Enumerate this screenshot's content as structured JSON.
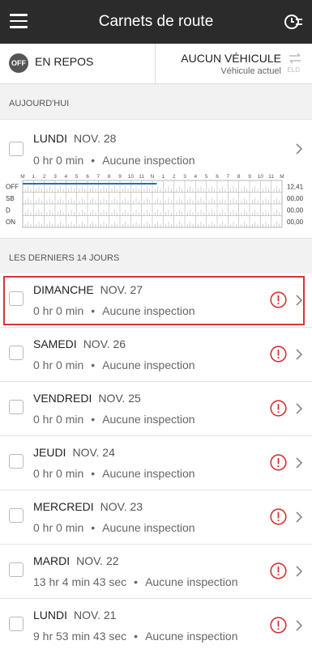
{
  "header": {
    "title": "Carnets de route",
    "menu_icon": "menu-icon",
    "clock_icon": "clock-list-icon"
  },
  "status": {
    "duty_badge": "OFF",
    "duty_label": "EN REPOS",
    "vehicle": "AUCUN VÉHICULE",
    "vehicle_sub": "Véhicule actuel",
    "eld_label": "ELD"
  },
  "today_section": "AUJOURD'HUI",
  "today": {
    "day": "LUNDI",
    "date": "NOV. 28",
    "hours": "0 hr 0 min",
    "inspection": "Aucune inspection",
    "graph": {
      "hour_labels": [
        "M",
        "1",
        "2",
        "3",
        "4",
        "5",
        "6",
        "7",
        "8",
        "9",
        "10",
        "11",
        "N",
        "1",
        "2",
        "3",
        "4",
        "5",
        "6",
        "7",
        "8",
        "9",
        "10",
        "11",
        "M"
      ],
      "rows": [
        {
          "label": "OFF",
          "total": "12,41"
        },
        {
          "label": "SB",
          "total": "00,00"
        },
        {
          "label": "D",
          "total": "00,00"
        },
        {
          "label": "ON",
          "total": "00,00"
        }
      ],
      "off_duty_hours": [
        0,
        12.41
      ],
      "line_color": "#1e6fc8"
    }
  },
  "past_section": "LES DERNIERS 14 JOURS",
  "days": [
    {
      "day": "DIMANCHE",
      "date": "NOV. 27",
      "hours": "0 hr 0 min",
      "inspection": "Aucune inspection"
    },
    {
      "day": "SAMEDI",
      "date": "NOV. 26",
      "hours": "0 hr 0 min",
      "inspection": "Aucune inspection"
    },
    {
      "day": "VENDREDI",
      "date": "NOV. 25",
      "hours": "0 hr 0 min",
      "inspection": "Aucune inspection"
    },
    {
      "day": "JEUDI",
      "date": "NOV. 24",
      "hours": "0 hr 0 min",
      "inspection": "Aucune inspection"
    },
    {
      "day": "MERCREDI",
      "date": "NOV. 23",
      "hours": "0 hr 0 min",
      "inspection": "Aucune inspection"
    },
    {
      "day": "MARDI",
      "date": "NOV. 22",
      "hours": "13 hr 4 min 43 sec",
      "inspection": "Aucune inspection"
    },
    {
      "day": "LUNDI",
      "date": "NOV. 21",
      "hours": "9 hr 53 min 43 sec",
      "inspection": "Aucune inspection"
    }
  ],
  "colors": {
    "appbar": "#2b2b2b",
    "alert": "#d33333",
    "selection": "#d33333"
  }
}
